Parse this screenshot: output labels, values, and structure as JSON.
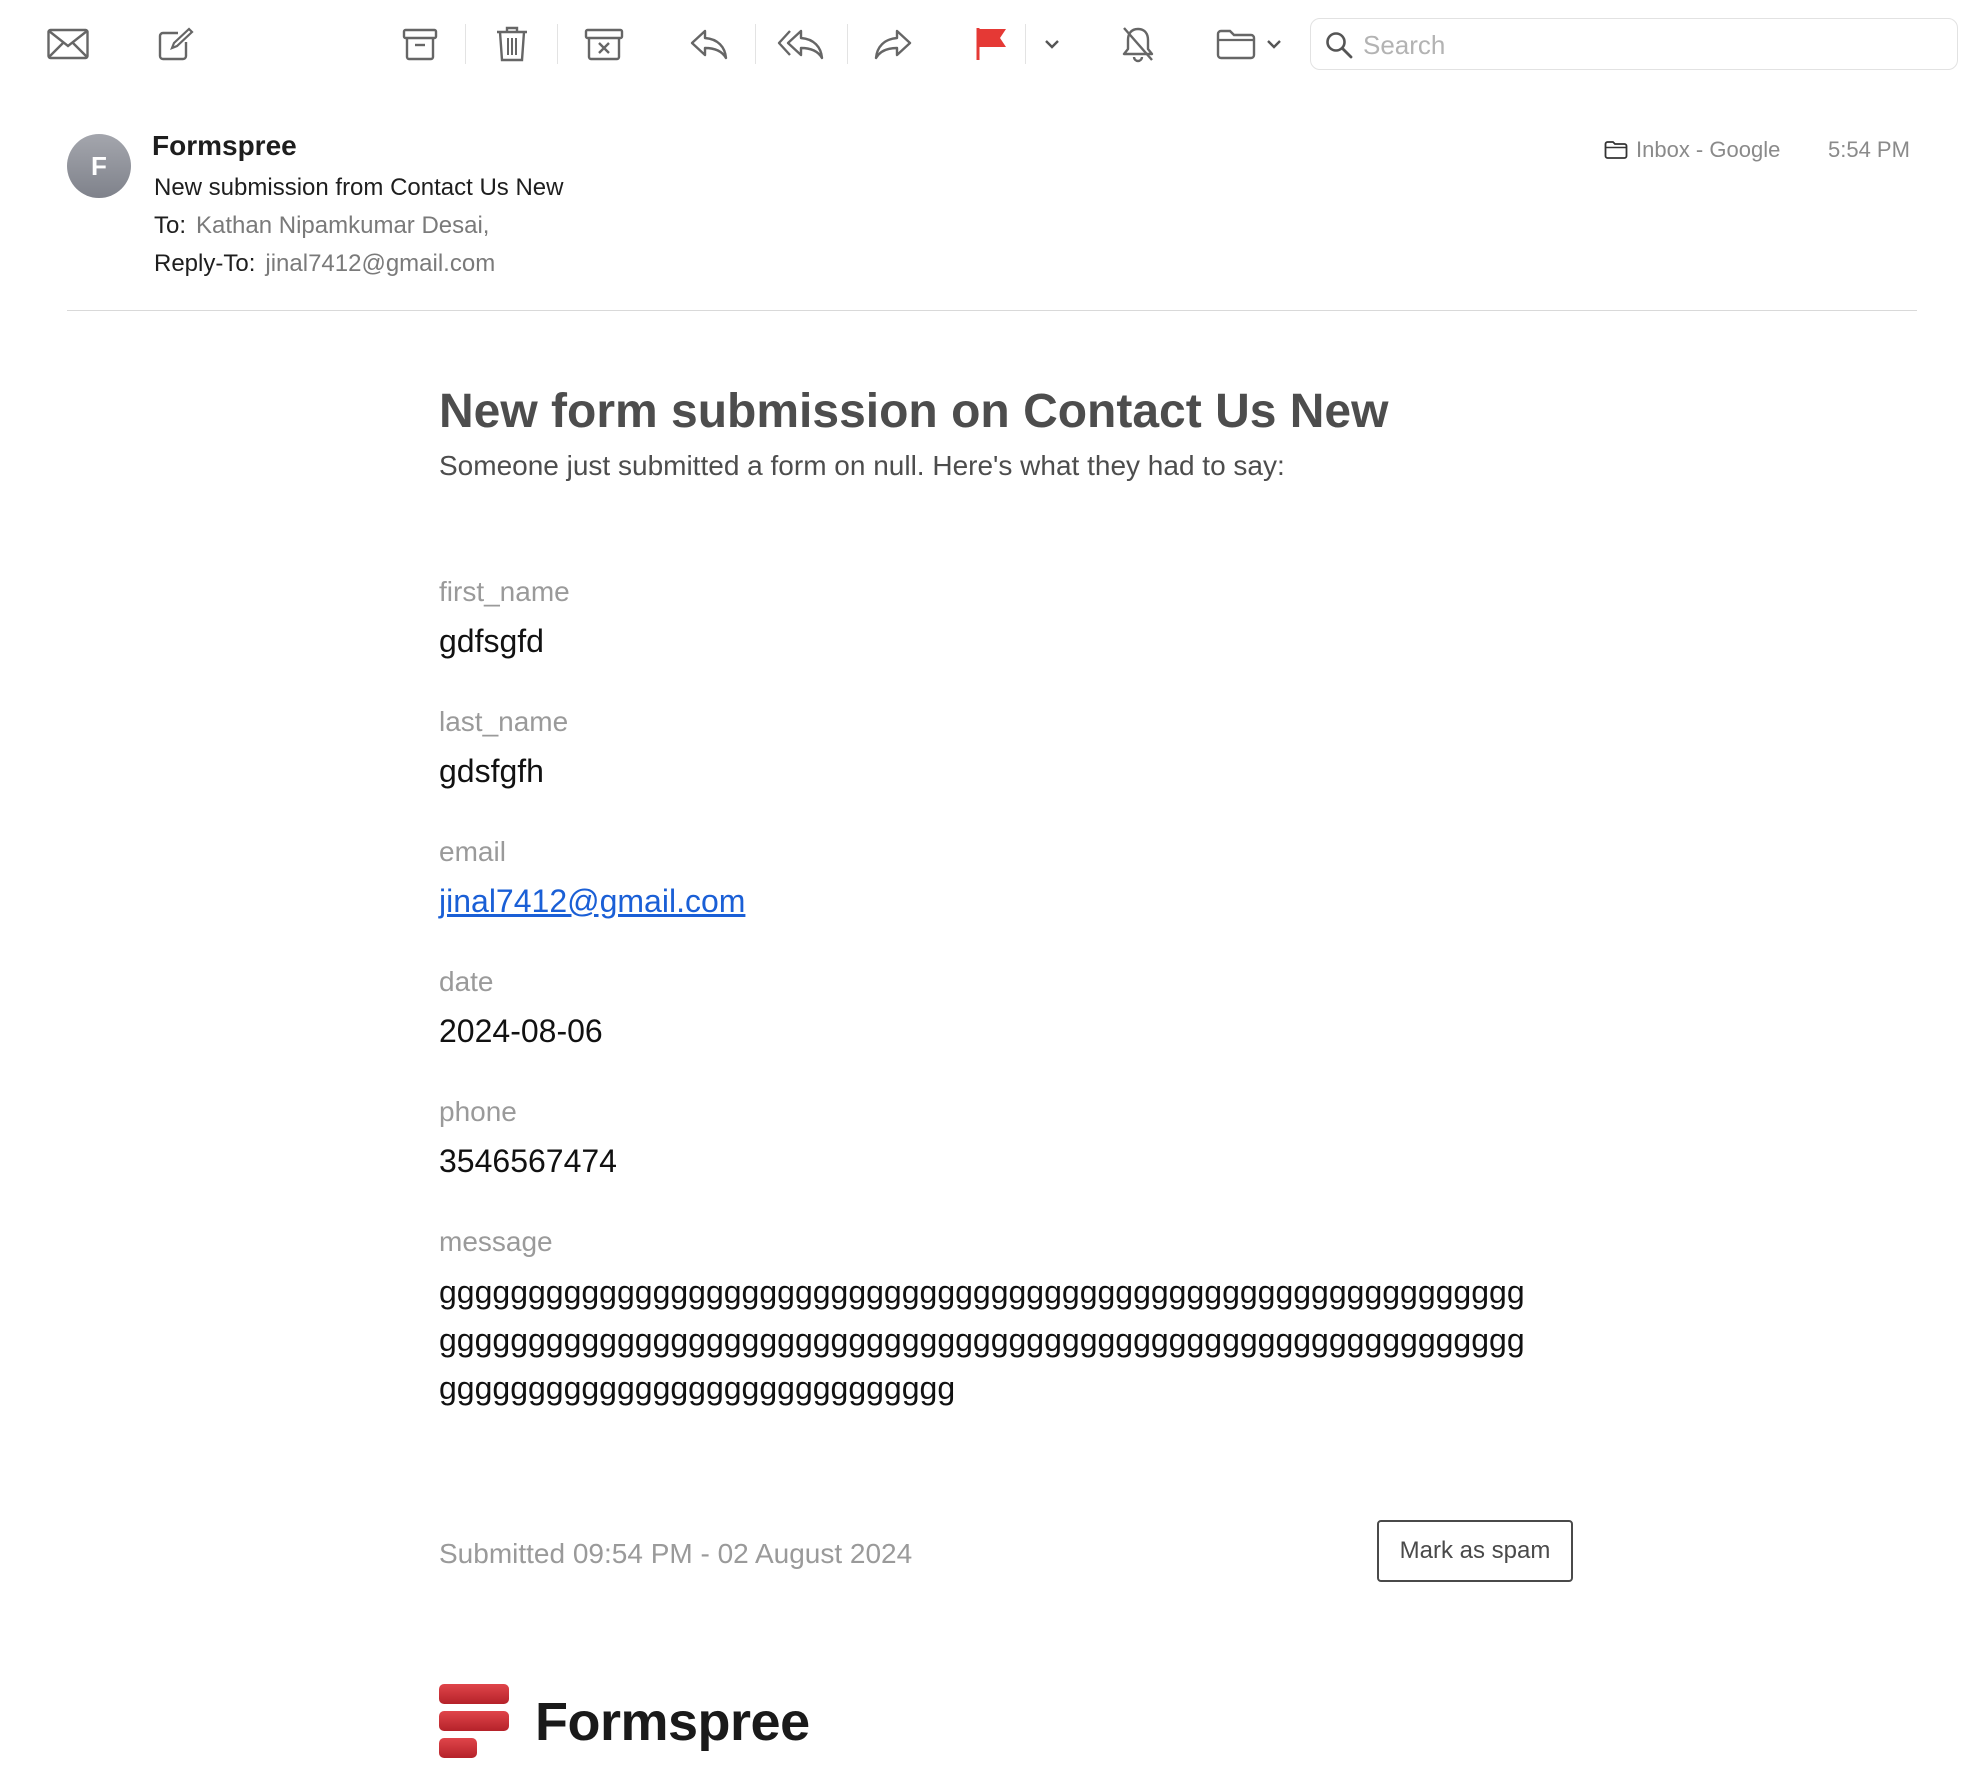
{
  "toolbar": {
    "icons": [
      "envelope-icon",
      "compose-icon",
      "archive-icon",
      "trash-icon",
      "junk-icon",
      "reply-icon",
      "reply-all-icon",
      "forward-icon",
      "flag-icon",
      "chevron-down-icon",
      "mute-icon",
      "folder-icon"
    ],
    "flag_color": "#e53935",
    "search_placeholder": "Search"
  },
  "email": {
    "avatar_initial": "F",
    "sender": "Formspree",
    "subject": "New submission from Contact Us New",
    "to_label": "To:",
    "to_value": "Kathan Nipamkumar Desai,",
    "reply_to_label": "Reply-To:",
    "reply_to_value": "jinal7412@gmail.com",
    "mailbox": "Inbox - Google",
    "time": "5:54 PM"
  },
  "body": {
    "title": "New form submission on Contact Us New",
    "intro": "Someone just submitted a form on null. Here's what they had to say:",
    "fields": [
      {
        "label": "first_name",
        "value": "gdfsgfd"
      },
      {
        "label": "last_name",
        "value": "gdsfgfh"
      },
      {
        "label": "email",
        "value": "jinal7412@gmail.com"
      },
      {
        "label": "date",
        "value": "2024-08-06"
      },
      {
        "label": "phone",
        "value": "3546567474"
      },
      {
        "label": "message",
        "value": "ggggggggggggggggggggggggggggggggggggggggggggggggggggggggggggggggggggggggggggggggggggggggggggggggggggggggggggggggggggggggggggggggggggggggggggggggggggggg"
      }
    ],
    "submitted": "Submitted 09:54 PM - 02 August 2024",
    "spam_button": "Mark as spam",
    "logo_text": "Formspree",
    "link_color": "#1a5fd6",
    "brand_color": "#d32f35"
  }
}
